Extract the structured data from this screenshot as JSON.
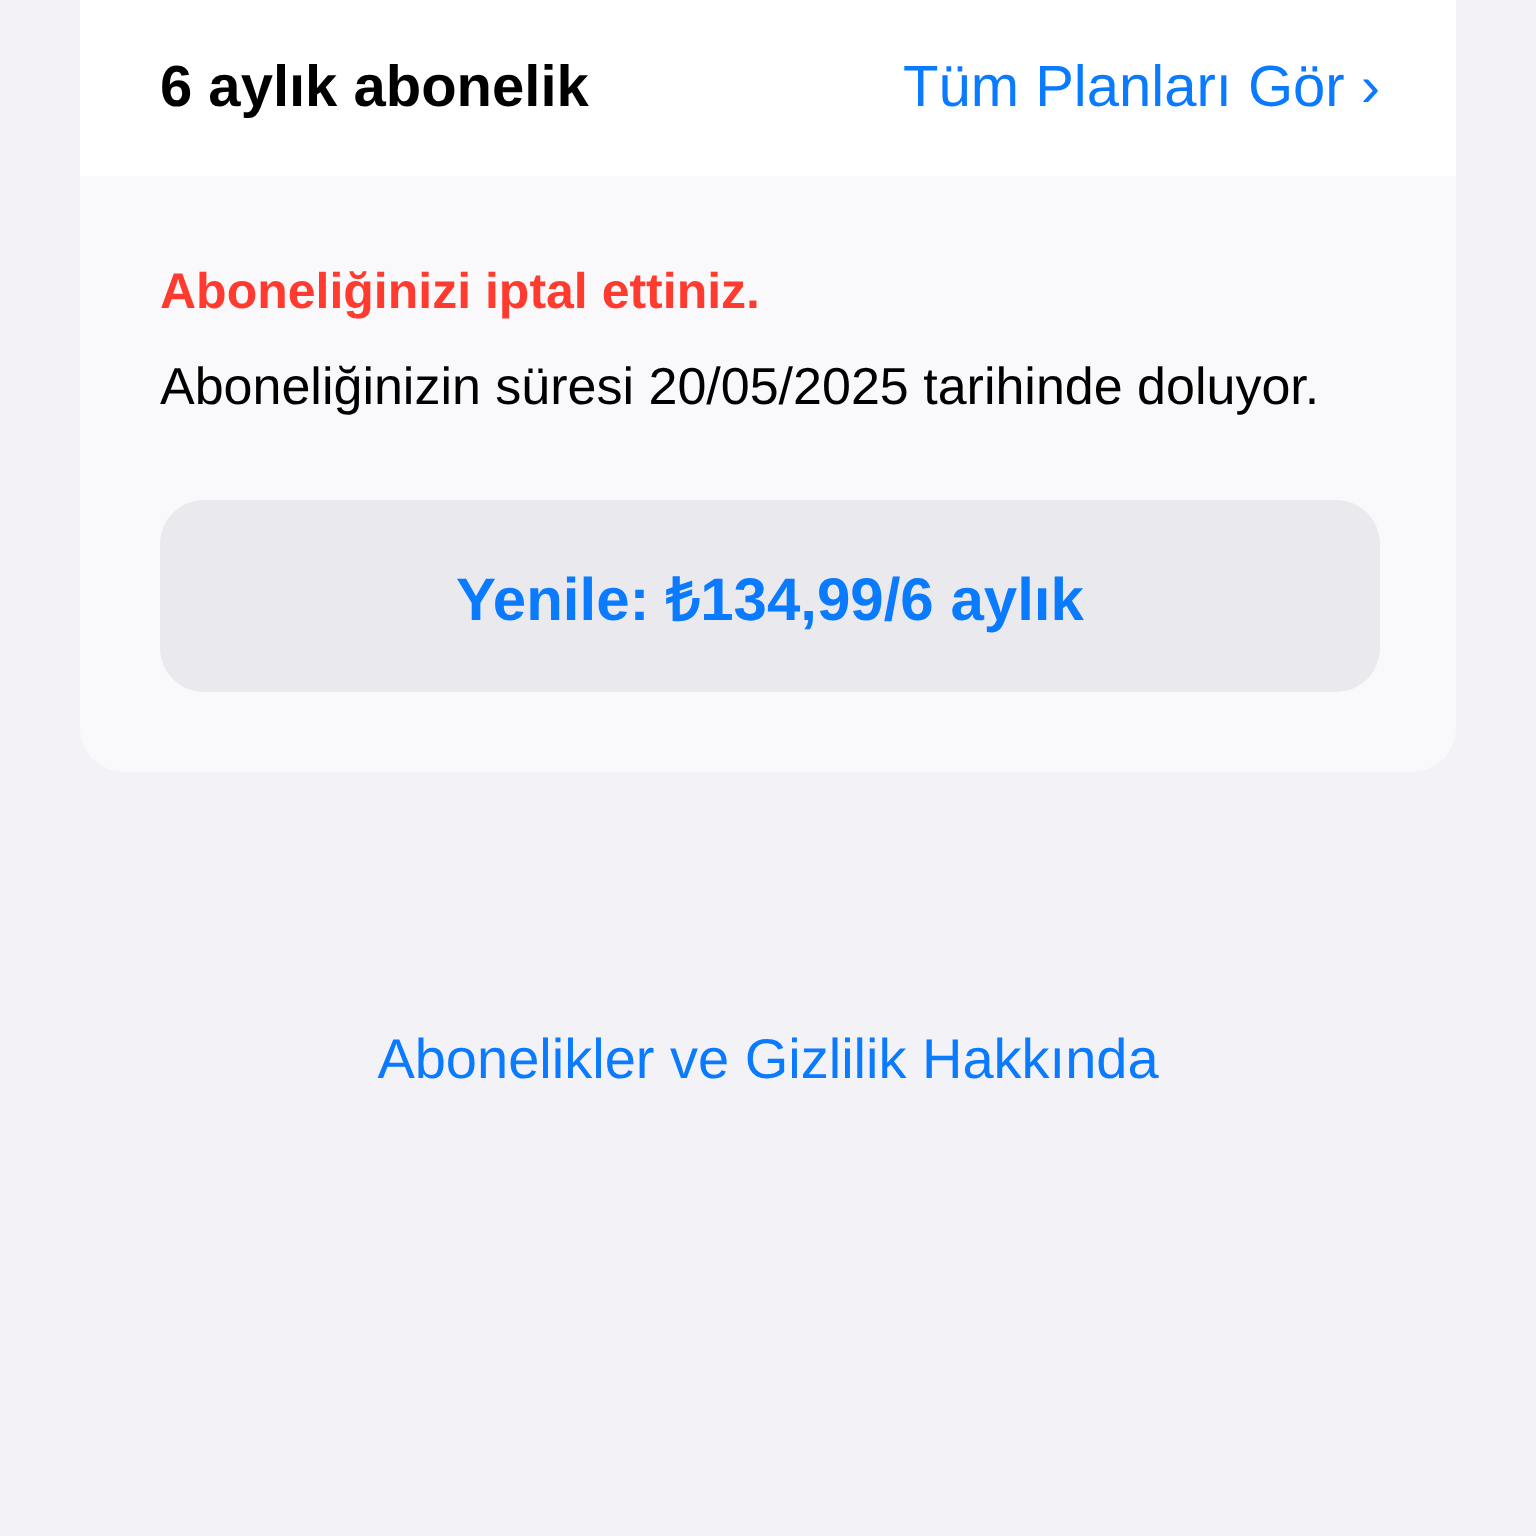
{
  "plan": {
    "title": "6 aylık abonelik",
    "all_plans_link": "Tüm Planları Gör",
    "chevron": "›"
  },
  "status": {
    "cancelled_notice": "Aboneliğinizi iptal ettiniz.",
    "expiry_text": "Aboneliğinizin süresi 20/05/2025 tarihinde doluyor.",
    "renew_button": "Yenile: ₺134,99/6 aylık"
  },
  "footer_link": "Abonelikler ve Gizlilik Hakkında"
}
